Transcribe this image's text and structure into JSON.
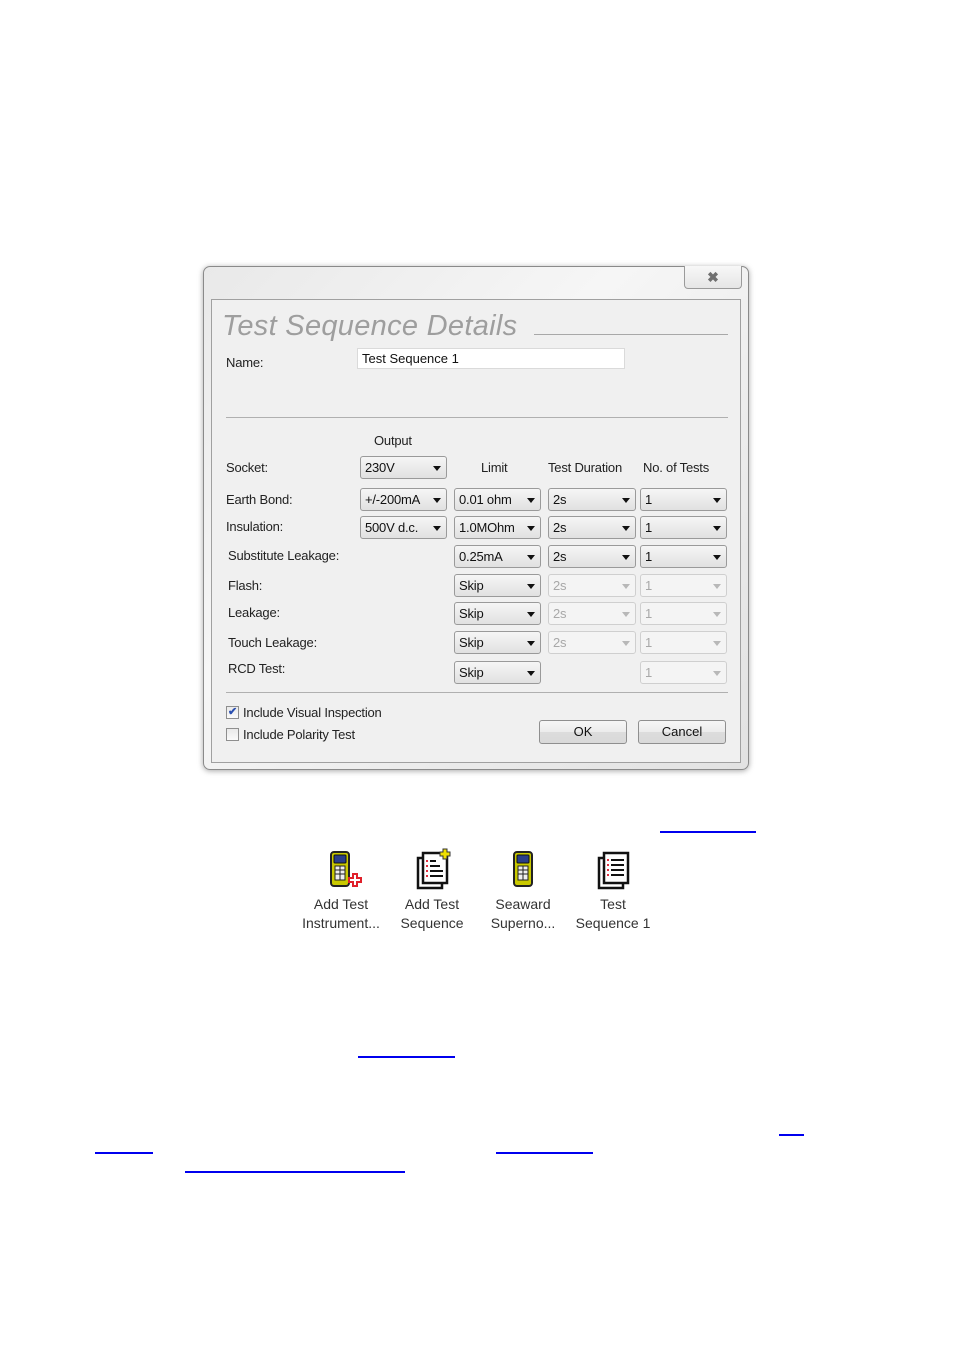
{
  "dialog": {
    "title": "Test Sequence Details",
    "close_icon": "close-x-icon",
    "name_label": "Name:",
    "name_value": "Test Sequence 1",
    "columns": {
      "output": "Output",
      "limit": "Limit",
      "test_duration": "Test Duration",
      "no_of_tests": "No. of Tests"
    },
    "rows": [
      {
        "label": "Socket:",
        "output": "230V"
      },
      {
        "label": "Earth Bond:",
        "output": "+/-200mA",
        "limit": "0.01 ohm",
        "duration": "2s",
        "count": "1"
      },
      {
        "label": "Insulation:",
        "output": "500V d.c.",
        "limit": "1.0MOhm",
        "duration": "2s",
        "count": "1"
      },
      {
        "label": "Substitute Leakage:",
        "limit": "0.25mA",
        "duration": "2s",
        "count": "1"
      },
      {
        "label": "Flash:",
        "limit": "Skip",
        "duration": "2s",
        "count": "1",
        "disabled": true
      },
      {
        "label": "Leakage:",
        "limit": "Skip",
        "duration": "2s",
        "count": "1",
        "disabled": true
      },
      {
        "label": "Touch Leakage:",
        "limit": "Skip",
        "duration": "2s",
        "count": "1",
        "disabled": true
      },
      {
        "label": "RCD Test:",
        "limit": "Skip",
        "count": "1",
        "disabled": true
      }
    ],
    "checkboxes": [
      {
        "label": "Include Visual Inspection",
        "checked": true
      },
      {
        "label": "Include Polarity Test",
        "checked": false
      }
    ],
    "ok_label": "OK",
    "cancel_label": "Cancel"
  },
  "toolbar_icons": [
    {
      "icon": "test-instrument-add-icon",
      "line1": "Add Test",
      "line2": "Instrument..."
    },
    {
      "icon": "sequence-add-icon",
      "line1": "Add Test",
      "line2": "Sequence"
    },
    {
      "icon": "test-instrument-icon",
      "line1": "Seaward",
      "line2": "Superno..."
    },
    {
      "icon": "sequence-document-icon",
      "line1": "Test",
      "line2": "Sequence 1"
    }
  ],
  "colors": {
    "link": "#0000ee",
    "instrument_yellow": "#d4d400",
    "add_red": "#e0202a",
    "add_yellow": "#f0e000"
  }
}
